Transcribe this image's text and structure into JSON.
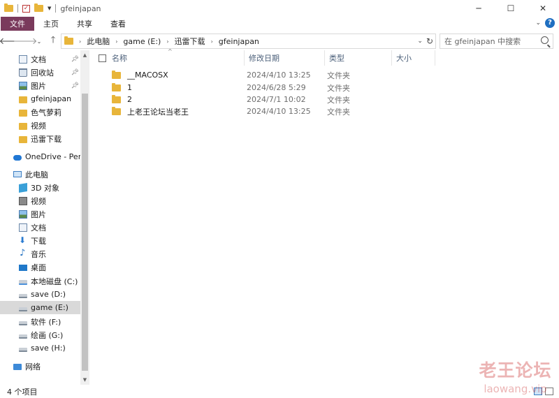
{
  "window": {
    "title": "gfeinjapan",
    "minimize": "─",
    "maximize": "☐",
    "close": "✕"
  },
  "ribbon": {
    "tabs": [
      {
        "label": "文件",
        "active": true
      },
      {
        "label": "主页",
        "active": false
      },
      {
        "label": "共享",
        "active": false
      },
      {
        "label": "查看",
        "active": false
      }
    ]
  },
  "address": {
    "crumbs": [
      "此电脑",
      "game (E:)",
      "迅雷下载",
      "gfeinjapan"
    ],
    "search_placeholder": "在 gfeinjapan 中搜索"
  },
  "sidebar": {
    "quick_access": [
      {
        "label": "文档",
        "icon": "document-icon",
        "pinned": true
      },
      {
        "label": "回收站",
        "icon": "recycle-bin-icon",
        "pinned": true
      },
      {
        "label": "图片",
        "icon": "pictures-icon",
        "pinned": true
      },
      {
        "label": "gfeinjapan",
        "icon": "folder-icon",
        "pinned": false
      },
      {
        "label": "色气萝莉",
        "icon": "folder-icon",
        "pinned": false
      },
      {
        "label": "视频",
        "icon": "folder-icon",
        "pinned": false
      },
      {
        "label": "迅雷下载",
        "icon": "folder-icon",
        "pinned": false
      }
    ],
    "onedrive": {
      "label": "OneDrive - Perso",
      "icon": "onedrive-icon"
    },
    "this_pc": {
      "label": "此电脑",
      "icon": "this-pc-icon"
    },
    "pc_items": [
      {
        "label": "3D 对象",
        "icon": "3d-objects-icon"
      },
      {
        "label": "视频",
        "icon": "videos-icon"
      },
      {
        "label": "图片",
        "icon": "pictures-icon"
      },
      {
        "label": "文档",
        "icon": "document-icon"
      },
      {
        "label": "下载",
        "icon": "downloads-icon"
      },
      {
        "label": "音乐",
        "icon": "music-icon"
      },
      {
        "label": "桌面",
        "icon": "desktop-icon"
      },
      {
        "label": "本地磁盘 (C:)",
        "icon": "system-drive-icon"
      },
      {
        "label": "save (D:)",
        "icon": "drive-icon"
      },
      {
        "label": "game (E:)",
        "icon": "drive-icon",
        "selected": true
      },
      {
        "label": "软件 (F:)",
        "icon": "drive-icon"
      },
      {
        "label": "绘画 (G:)",
        "icon": "drive-icon"
      },
      {
        "label": "save (H:)",
        "icon": "drive-icon"
      }
    ],
    "network": {
      "label": "网络",
      "icon": "network-icon"
    }
  },
  "columns": {
    "name": "名称",
    "modified": "修改日期",
    "type": "类型",
    "size": "大小"
  },
  "files": [
    {
      "name": "__MACOSX",
      "modified": "2024/4/10 13:25",
      "type": "文件夹",
      "size": ""
    },
    {
      "name": "1",
      "modified": "2024/6/28 5:29",
      "type": "文件夹",
      "size": ""
    },
    {
      "name": "2",
      "modified": "2024/7/1 10:02",
      "type": "文件夹",
      "size": ""
    },
    {
      "name": "上老王论坛当老王",
      "modified": "2024/4/10 13:25",
      "type": "文件夹",
      "size": ""
    }
  ],
  "status": {
    "count_text": "4 个项目"
  },
  "watermark": {
    "main": "老王论坛",
    "sub": "laowang.vip"
  }
}
